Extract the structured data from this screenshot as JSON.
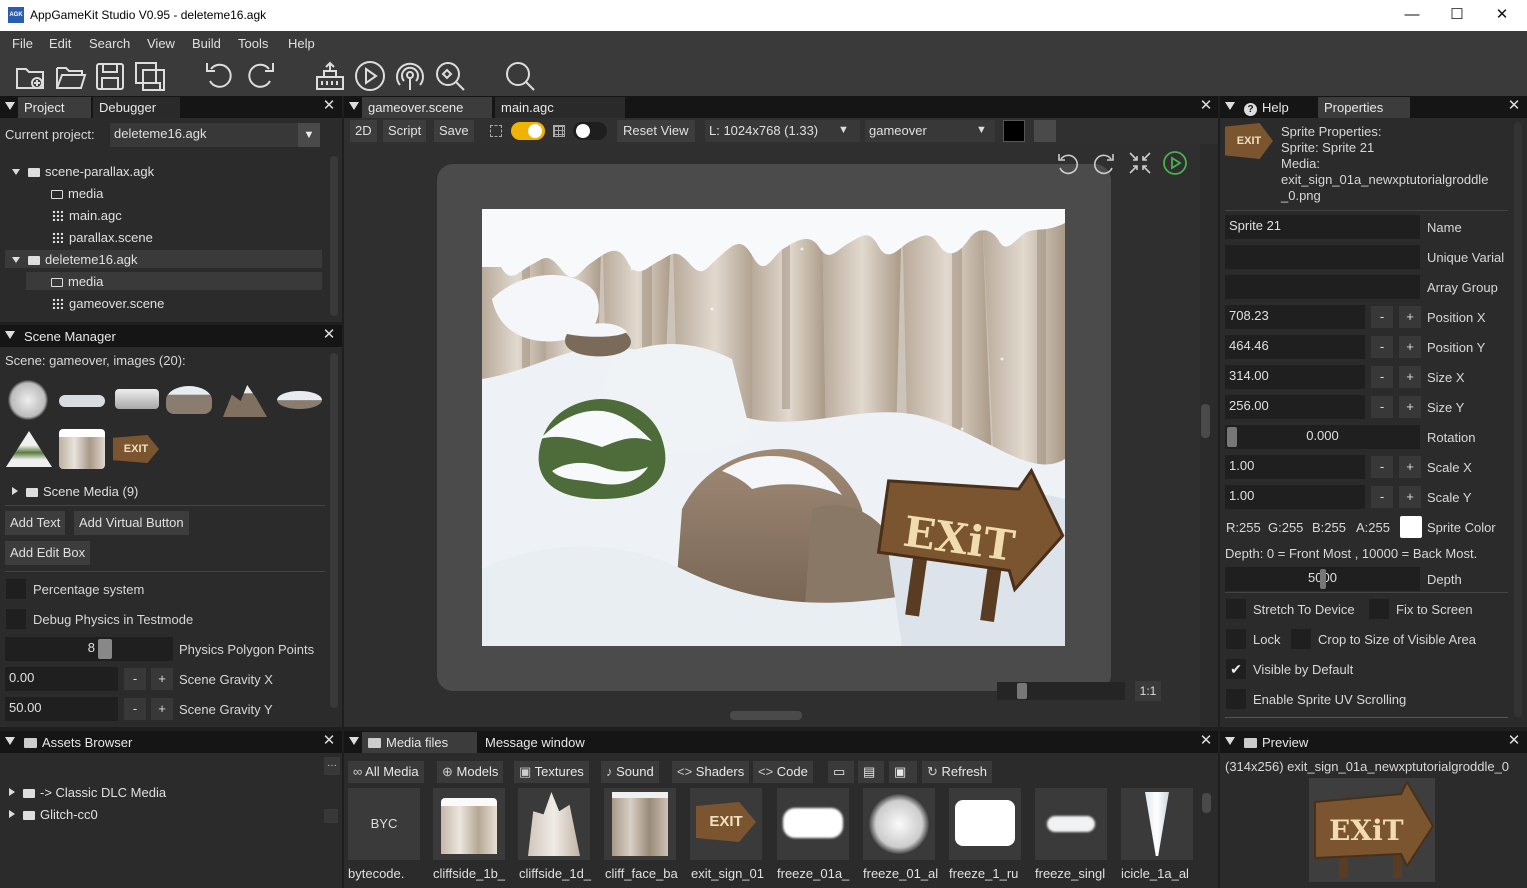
{
  "window": {
    "title": "AppGameKit Studio V0.95 - deleteme16.agk",
    "icon_text": "AGK",
    "min": "—",
    "max": "☐",
    "close": "✕"
  },
  "menu": [
    "File",
    "Edit",
    "Search",
    "View",
    "Build",
    "Tools",
    "Help"
  ],
  "toolbar_icons": [
    "new-project-icon",
    "open-icon",
    "save-icon",
    "save-all-icon",
    "undo-icon",
    "redo-icon",
    "build-icon",
    "run-icon",
    "broadcast-icon",
    "debug-icon",
    "search-icon"
  ],
  "project_panel": {
    "tabs": [
      "Project",
      "Debugger"
    ],
    "current_project_label": "Current project:",
    "current_project": "deleteme16.agk",
    "tree": [
      {
        "label": "scene-parallax.agk",
        "type": "project"
      },
      {
        "label": "media",
        "type": "folder"
      },
      {
        "label": "main.agc",
        "type": "file"
      },
      {
        "label": "parallax.scene",
        "type": "file"
      },
      {
        "label": "deleteme16.agk",
        "type": "project"
      },
      {
        "label": "media",
        "type": "folder"
      },
      {
        "label": "gameover.scene",
        "type": "file"
      }
    ]
  },
  "scene_manager": {
    "title": "Scene Manager",
    "scene_info": "Scene: gameover, images (20):",
    "scene_media": "Scene Media (9)",
    "buttons": {
      "add_text": "Add Text",
      "add_virtual_button": "Add Virtual Button",
      "add_edit_box": "Add Edit Box"
    },
    "percentage_system": "Percentage system",
    "debug_physics": "Debug Physics in Testmode",
    "physics_points_value": "8",
    "physics_points_label": "Physics Polygon Points",
    "gravity_x": "0.00",
    "gravity_x_label": "Scene Gravity X",
    "gravity_y": "50.00",
    "gravity_y_label": "Scene Gravity Y",
    "exit_thumb_text": "EXIT"
  },
  "assets": {
    "title": "Assets Browser",
    "more": "···",
    "items": [
      "-> Classic DLC Media",
      "Glitch-cc0"
    ]
  },
  "editor": {
    "tabs": [
      "gameover.scene",
      "main.agc"
    ],
    "bar": {
      "mode": "2D",
      "script": "Script",
      "save": "Save",
      "reset": "Reset View",
      "resolution": "L: 1024x768 (1.33)",
      "scene": "gameover"
    },
    "zoom_label": "1:1",
    "exit_sign_text": "EXiT"
  },
  "help_props": {
    "tabs": [
      "Help",
      "Properties"
    ],
    "header_lines": [
      "Sprite Properties:",
      "Sprite: Sprite 21",
      "Media:",
      "exit_sign_01a_newxptutorialgroddle",
      "_0.png"
    ],
    "header_thumb_text": "EXIT",
    "rows": [
      {
        "value": "Sprite 21",
        "label": "Name"
      },
      {
        "value": "",
        "label": "Unique Varial"
      },
      {
        "value": "",
        "label": "Array Group"
      },
      {
        "value": "708.23",
        "label": "Position X"
      },
      {
        "value": "464.46",
        "label": "Position Y"
      },
      {
        "value": "314.00",
        "label": "Size X"
      },
      {
        "value": "256.00",
        "label": "Size Y"
      },
      {
        "value": "0.000",
        "label": "Rotation"
      },
      {
        "value": "1.00",
        "label": "Scale X"
      },
      {
        "value": "1.00",
        "label": "Scale Y"
      }
    ],
    "color": {
      "r": "R:255",
      "g": "G:255",
      "b": "B:255",
      "a": "A:255",
      "label": "Sprite Color"
    },
    "depth_note": "Depth: 0 = Front Most , 10000 = Back Most.",
    "depth_value": "5000",
    "depth_label": "Depth",
    "checks": {
      "stretch": "Stretch To Device",
      "fix": "Fix to Screen",
      "lock": "Lock",
      "crop": "Crop to Size of Visible Area",
      "visible": "Visible by Default",
      "uv": "Enable Sprite UV Scrolling"
    }
  },
  "media_files": {
    "tabs": [
      "Media files",
      "Message window"
    ],
    "filters": [
      "All Media",
      "Models",
      "Textures",
      "Sound",
      "Shaders",
      "Code",
      "Refresh"
    ],
    "byc": "BYC",
    "exit_thumb_text": "EXIT",
    "items": [
      "bytecode.",
      "cliffside_1b_",
      "cliffside_1d_",
      "cliff_face_ba",
      "exit_sign_01",
      "freeze_01a_",
      "freeze_01_al",
      "freeze_1_ru",
      "freeze_singl",
      "icicle_1a_al"
    ]
  },
  "preview": {
    "title": "Preview",
    "caption": "(314x256) exit_sign_01a_newxptutorialgroddle_0",
    "thumb_text": "EXiT"
  },
  "colors": {
    "accent": "#f0b400",
    "panel": "#2b2b2b",
    "header": "#151515"
  }
}
